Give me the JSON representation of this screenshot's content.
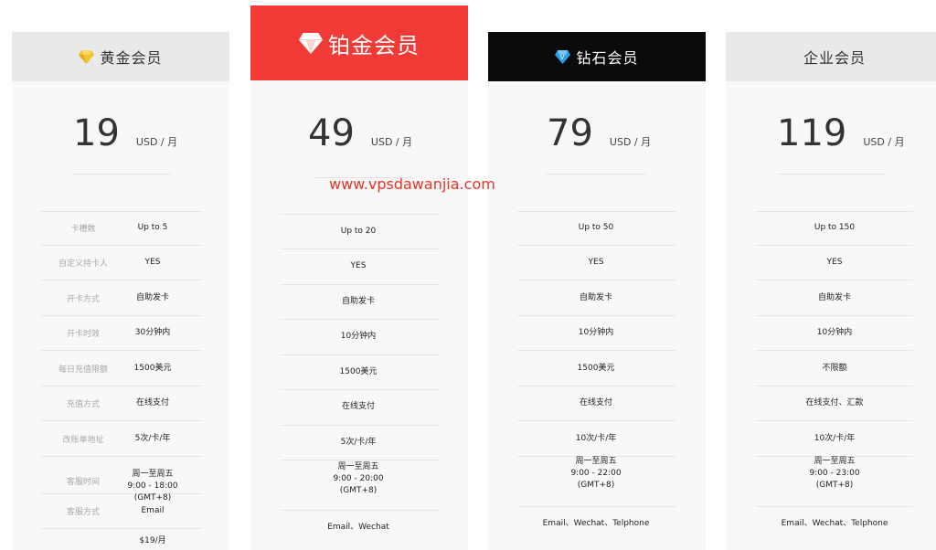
{
  "watermark": "www.vpsdawanjia.com",
  "colors": {
    "gold": "#f2c12e",
    "diamond": "#2aa0e8",
    "platinum_header": "#f23a36",
    "diamond_header": "#0b0b0b"
  },
  "labels": [
    "卡槽数",
    "自定义持卡人",
    "开卡方式",
    "开卡时效",
    "每日充值限额",
    "充值方式",
    "改账单地址",
    "客服时间",
    "客服方式"
  ],
  "plans": [
    {
      "name": "黄金会员",
      "icon": "gold-diamond-icon",
      "price": "19",
      "unit": "USD / 月",
      "values": [
        "Up to 5",
        "YES",
        "自助发卡",
        "30分钟内",
        "1500美元",
        "在线支付",
        "5次/卡/年",
        [
          "周一至周五",
          "9:00 - 18:00 (GMT+8)"
        ],
        "Email",
        "$19/月"
      ]
    },
    {
      "name": "铂金会员",
      "icon": "white-diamond-icon",
      "price": "49",
      "unit": "USD / 月",
      "values": [
        "Up to 20",
        "YES",
        "自助发卡",
        "10分钟内",
        "1500美元",
        "在线支付",
        "5次/卡/年",
        [
          "周一至周五",
          "9:00 - 20:00",
          "(GMT+8)"
        ],
        "Email、Wechat"
      ]
    },
    {
      "name": "钻石会员",
      "icon": "blue-diamond-icon",
      "price": "79",
      "unit": "USD / 月",
      "values": [
        "Up to 50",
        "YES",
        "自助发卡",
        "10分钟内",
        "1500美元",
        "在线支付",
        "10次/卡/年",
        [
          "周一至周五",
          "9:00 - 22:00",
          "(GMT+8)"
        ],
        "Email、Wechat、Telphone"
      ]
    },
    {
      "name": "企业会员",
      "icon": "",
      "price": "119",
      "unit": "USD / 月",
      "values": [
        "Up to 150",
        "YES",
        "自助发卡",
        "10分钟内",
        "不限额",
        "在线支付、汇款",
        "10次/卡/年",
        [
          "周一至周五",
          "9:00 - 23:00",
          "(GMT+8)"
        ],
        "Email、Wechat、Telphone"
      ]
    }
  ]
}
